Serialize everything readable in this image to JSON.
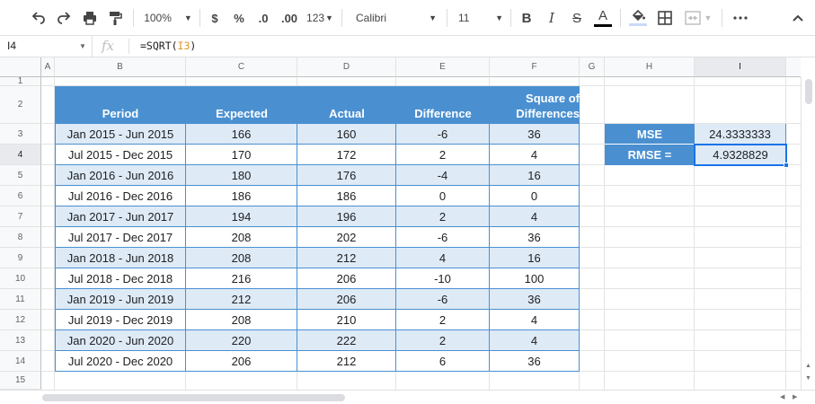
{
  "toolbar": {
    "zoom": "100%",
    "currency": "$",
    "percent": "%",
    "dec_decrease": ".0",
    "dec_increase": ".00",
    "number_format": "123",
    "font": "Calibri",
    "font_size": "11",
    "bold": "B",
    "italic": "I",
    "strike": "S",
    "text_color": "A",
    "more": "⋮"
  },
  "formula_bar": {
    "cell_ref": "I4",
    "fx": "fx",
    "formula_prefix": "=SQRT(",
    "formula_ref": "I3",
    "formula_suffix": ")"
  },
  "columns": [
    "A",
    "B",
    "C",
    "D",
    "E",
    "F",
    "G",
    "H",
    "I"
  ],
  "rows": [
    "1",
    "2",
    "3",
    "4",
    "5",
    "6",
    "7",
    "8",
    "9",
    "10",
    "11",
    "12",
    "13",
    "14",
    "15"
  ],
  "table": {
    "headers": [
      "Period",
      "Expected",
      "Actual",
      "Difference",
      "Square of Differences"
    ],
    "header_sq_line1": "Square of",
    "header_sq_line2": "Differences",
    "rows": [
      [
        "Jan 2015 - Jun 2015",
        "166",
        "160",
        "-6",
        "36"
      ],
      [
        "Jul 2015 - Dec 2015",
        "170",
        "172",
        "2",
        "4"
      ],
      [
        "Jan 2016 - Jun 2016",
        "180",
        "176",
        "-4",
        "16"
      ],
      [
        "Jul 2016 - Dec 2016",
        "186",
        "186",
        "0",
        "0"
      ],
      [
        "Jan 2017 - Jun 2017",
        "194",
        "196",
        "2",
        "4"
      ],
      [
        "Jul 2017 - Dec 2017",
        "208",
        "202",
        "-6",
        "36"
      ],
      [
        "Jan 2018 - Jun 2018",
        "208",
        "212",
        "4",
        "16"
      ],
      [
        "Jul 2018 - Dec 2018",
        "216",
        "206",
        "-10",
        "100"
      ],
      [
        "Jan 2019 - Jun 2019",
        "212",
        "206",
        "-6",
        "36"
      ],
      [
        "Jul 2019 - Dec 2019",
        "208",
        "210",
        "2",
        "4"
      ],
      [
        "Jan 2020 - Jun 2020",
        "220",
        "222",
        "2",
        "4"
      ],
      [
        "Jul 2020 - Dec 2020",
        "206",
        "212",
        "6",
        "36"
      ]
    ]
  },
  "summary": {
    "mse_label": "MSE",
    "mse_value": "24.3333333",
    "rmse_label": "RMSE =",
    "rmse_value": "4.9328829"
  },
  "colors": {
    "header_fill": "#4a90d1",
    "band_fill": "#deeaf6",
    "selection": "#1a73e8"
  }
}
